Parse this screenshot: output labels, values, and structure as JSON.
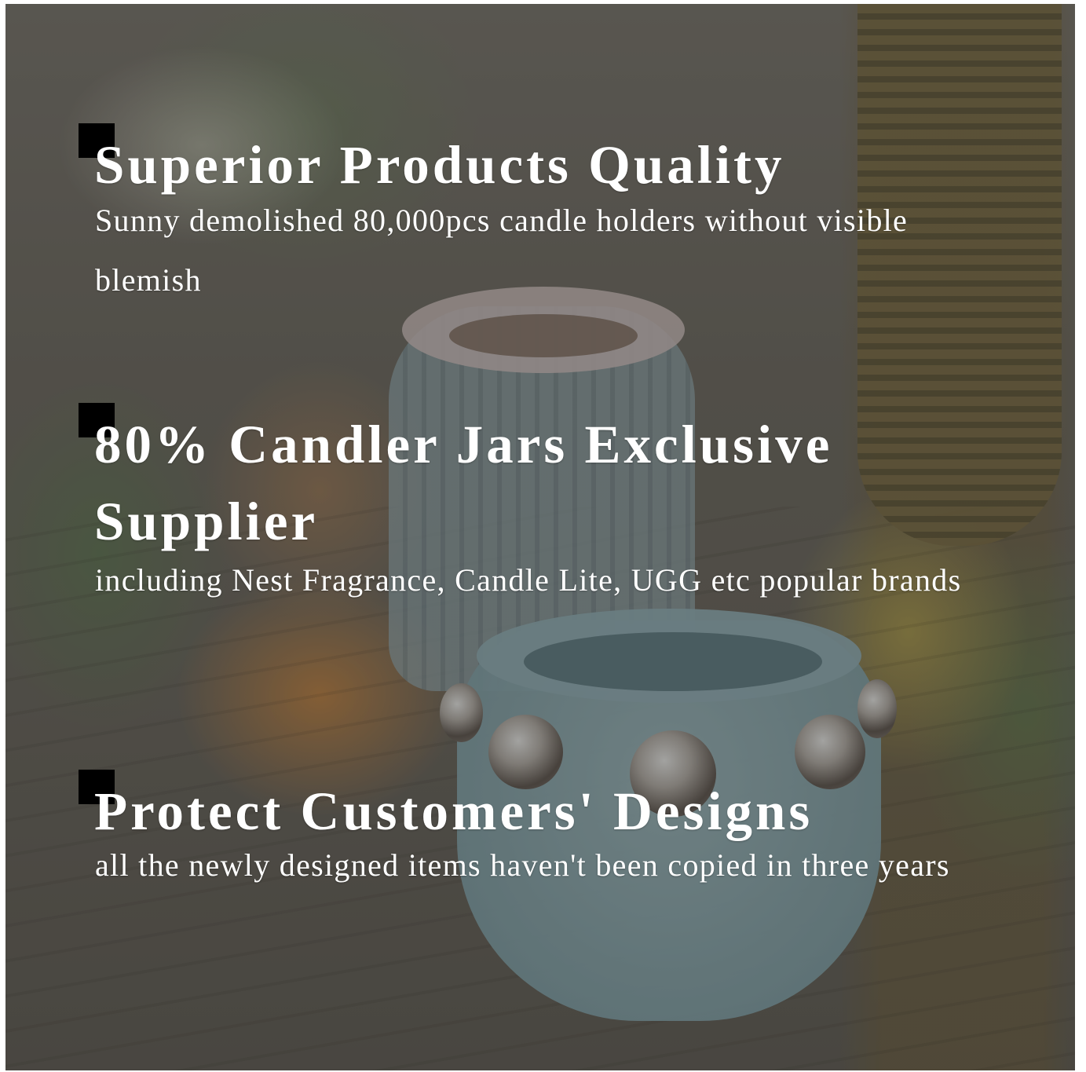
{
  "features": [
    {
      "title": "Superior Products Quality",
      "description": "Sunny demolished 80,000pcs candle holders without visible blemish"
    },
    {
      "title": "80% Candler Jars Exclusive Supplier",
      "description": "including Nest Fragrance, Candle Lite, UGG etc popular brands"
    },
    {
      "title": "Protect Customers' Designs",
      "description": "all the newly designed items haven't been copied in three years"
    }
  ],
  "colors": {
    "text": "#ffffff",
    "marker": "#000000",
    "overlay": "#23211e"
  }
}
